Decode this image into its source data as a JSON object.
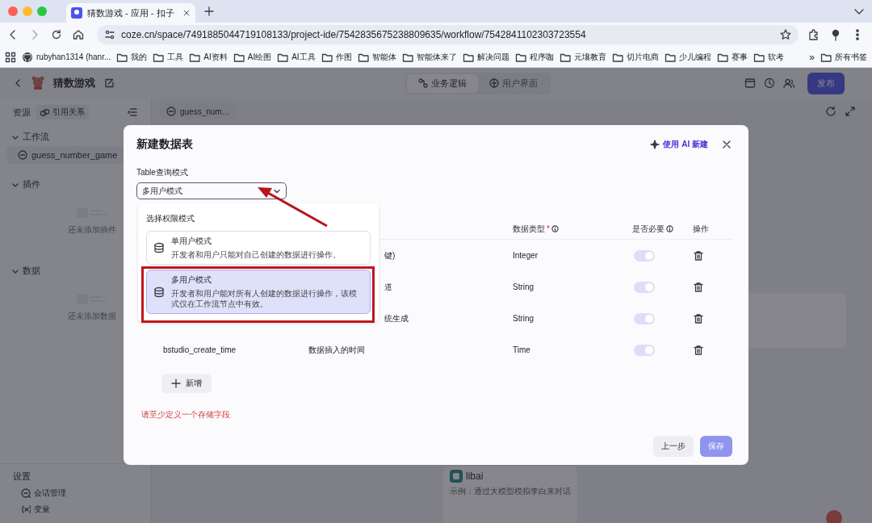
{
  "browser": {
    "tab_title": "猜数游戏 - 应用 - 扣子",
    "address": "coze.cn/space/7491885044719108133/project-ide/7542835675238809635/workflow/7542841102303723554",
    "bookmarks": [
      {
        "label": "rubyhan1314 (hanr...",
        "kind": "github"
      },
      {
        "label": "我的",
        "kind": "folder"
      },
      {
        "label": "工具",
        "kind": "folder"
      },
      {
        "label": "AI资料",
        "kind": "folder"
      },
      {
        "label": "AI绘图",
        "kind": "folder"
      },
      {
        "label": "AI工具",
        "kind": "folder"
      },
      {
        "label": "作图",
        "kind": "folder"
      },
      {
        "label": "智能体",
        "kind": "folder"
      },
      {
        "label": "智能体来了",
        "kind": "folder"
      },
      {
        "label": "解决问题",
        "kind": "folder"
      },
      {
        "label": "程序咖",
        "kind": "folder"
      },
      {
        "label": "元壤教育",
        "kind": "folder"
      },
      {
        "label": "切片电商",
        "kind": "folder"
      },
      {
        "label": "少儿编程",
        "kind": "folder"
      },
      {
        "label": "赛事",
        "kind": "folder"
      },
      {
        "label": "软考",
        "kind": "folder"
      }
    ],
    "overflow": "»",
    "all_bookmarks": "所有书签"
  },
  "app": {
    "title": "猜数游戏",
    "view_tabs": [
      {
        "label": "业务逻辑",
        "selected": true
      },
      {
        "label": "用户界面",
        "selected": false
      }
    ],
    "publish": "发布"
  },
  "sidebar": {
    "heading": "资源",
    "references": "引用关系",
    "sections": [
      {
        "title": "工作流",
        "expanded": true,
        "items": [
          "guess_number_game"
        ]
      },
      {
        "title": "插件",
        "expanded": true,
        "empty": "还未添加插件"
      },
      {
        "title": "数据",
        "expanded": true,
        "empty": "还未添加数据"
      }
    ],
    "settings": {
      "heading": "设置",
      "items": [
        {
          "label": "会话管理",
          "kind": "chat"
        },
        {
          "label": "变量",
          "kind": "variable"
        }
      ]
    }
  },
  "canvas": {
    "tab": "guess_num…",
    "card": {
      "name": "libai",
      "description": "示例：通过大模型模拟李白来对话"
    }
  },
  "dialog": {
    "title": "新建数据表",
    "ai_action": "使用 AI 新建",
    "mode_label": "Table查询模式",
    "mode_value": "多用户模式",
    "dropdown": {
      "heading": "选择权限模式",
      "options": [
        {
          "title": "单用户模式",
          "description": "开发者和用户只能对自己创建的数据进行操作。",
          "selected": false
        },
        {
          "title": "多用户模式",
          "description": "开发者和用户能对所有人创建的数据进行操作，该模式仅在工作流节点中有效。",
          "selected": true
        }
      ]
    },
    "columns": [
      {
        "label": "数据类型",
        "marker": "*",
        "info": true
      },
      {
        "label": "是否必要",
        "info": true
      },
      {
        "label": "操作"
      }
    ],
    "rows": [
      {
        "description": "键)",
        "cut": true,
        "type": "Integer",
        "required": true
      },
      {
        "description": "道",
        "cut": true,
        "type": "String",
        "required": true
      },
      {
        "description": "统生成",
        "cut": true,
        "type": "String",
        "required": true
      },
      {
        "name": "bstudio_create_time",
        "description": "数据插入的时间",
        "cut": false,
        "type": "Time",
        "required": true
      }
    ],
    "add": "新增",
    "error": "请至少定义一个存储字段",
    "back": "上一步",
    "save": "保存",
    "save_disabled": true
  }
}
